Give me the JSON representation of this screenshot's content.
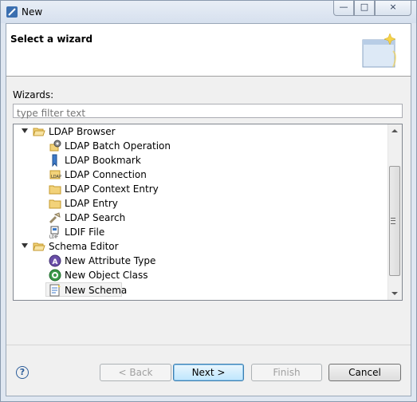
{
  "window": {
    "title": "New",
    "controls": {
      "minimize": "—",
      "maximize": "□",
      "close": "×"
    }
  },
  "banner": {
    "title": "Select a wizard"
  },
  "wizards_label": "Wizards:",
  "filter": {
    "value": "",
    "placeholder": "type filter text"
  },
  "tree": {
    "items": [
      {
        "label": "LDAP Browser",
        "type": "category",
        "expanded": true,
        "icon": "folder-open-icon"
      },
      {
        "label": "LDAP Batch Operation",
        "type": "item",
        "icon": "batch-operation-icon"
      },
      {
        "label": "LDAP Bookmark",
        "type": "item",
        "icon": "bookmark-icon"
      },
      {
        "label": "LDAP Connection",
        "type": "item",
        "icon": "ldap-connection-icon"
      },
      {
        "label": "LDAP Context Entry",
        "type": "item",
        "icon": "context-entry-icon"
      },
      {
        "label": "LDAP Entry",
        "type": "item",
        "icon": "entry-folder-icon"
      },
      {
        "label": "LDAP Search",
        "type": "item",
        "icon": "search-icon"
      },
      {
        "label": "LDIF File",
        "type": "item",
        "icon": "ldif-file-icon"
      },
      {
        "label": "Schema Editor",
        "type": "category",
        "expanded": true,
        "icon": "folder-open-icon"
      },
      {
        "label": "New Attribute Type",
        "type": "item",
        "icon": "attribute-type-icon"
      },
      {
        "label": "New Object Class",
        "type": "item",
        "icon": "object-class-icon"
      },
      {
        "label": "New Schema",
        "type": "item",
        "icon": "schema-file-icon",
        "selected": true
      }
    ]
  },
  "buttons": {
    "help": "?",
    "back": "< Back",
    "next": "Next >",
    "finish": "Finish",
    "cancel": "Cancel"
  },
  "colors": {
    "selection_bg": "#f3f3f3",
    "default_button": "#3c7fb1",
    "disabled_text": "#a0a0a0"
  }
}
